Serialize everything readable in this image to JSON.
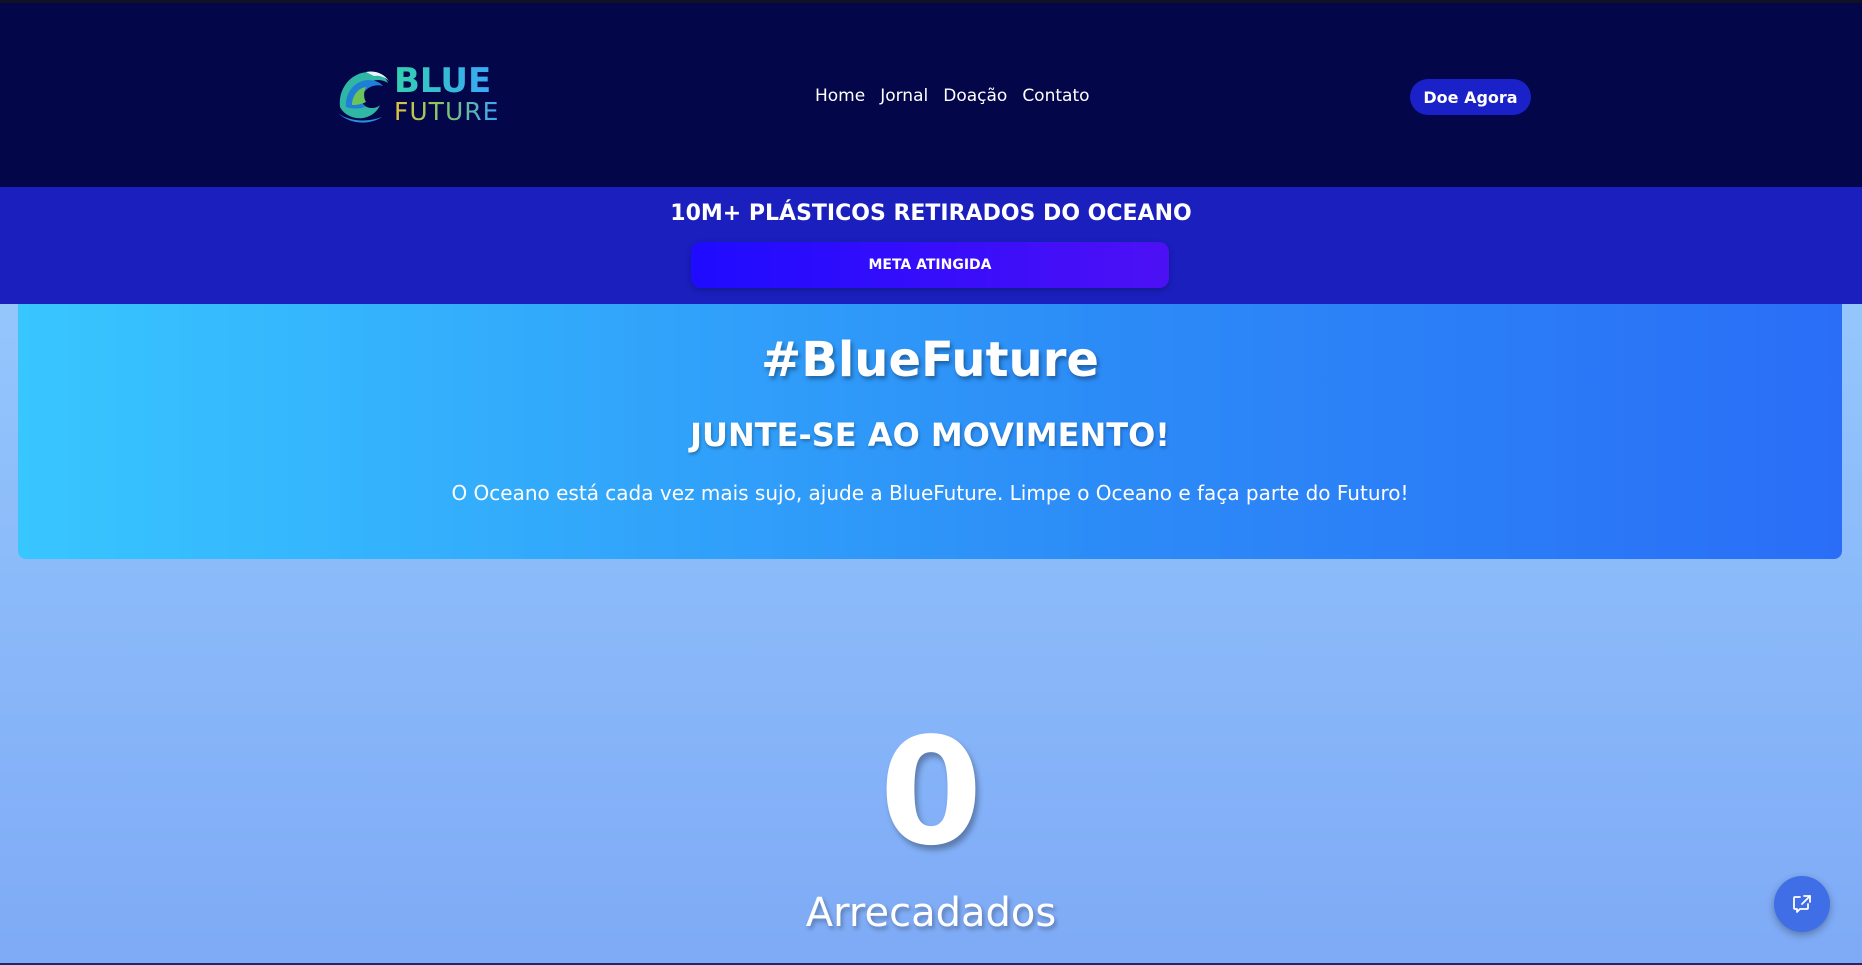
{
  "header": {
    "logo": {
      "line1": "BLUE",
      "line2": "FUTURE"
    },
    "nav": [
      {
        "label": "Home"
      },
      {
        "label": "Jornal"
      },
      {
        "label": "Doação"
      },
      {
        "label": "Contato"
      }
    ],
    "donate_label": "Doe Agora"
  },
  "banner": {
    "title": "10M+ PLÁSTICOS RETIRADOS DO OCEANO",
    "goal_label": "META ATINGIDA"
  },
  "hero": {
    "title": "#BlueFuture",
    "subtitle": "JUNTE-SE AO MOVIMENTO!",
    "text": "O Oceano está cada vez mais sujo, ajude a BlueFuture. Limpe o Oceano e faça parte do Futuro!"
  },
  "counter": {
    "value": "0",
    "label": "Arrecadados"
  },
  "floating": {
    "icon": "external-chat-icon"
  },
  "colors": {
    "header_bg": "#04064a",
    "banner_bg": "#1a1fbe",
    "accent_button": "#1b21c9",
    "goal_button": "#1f0bff"
  }
}
